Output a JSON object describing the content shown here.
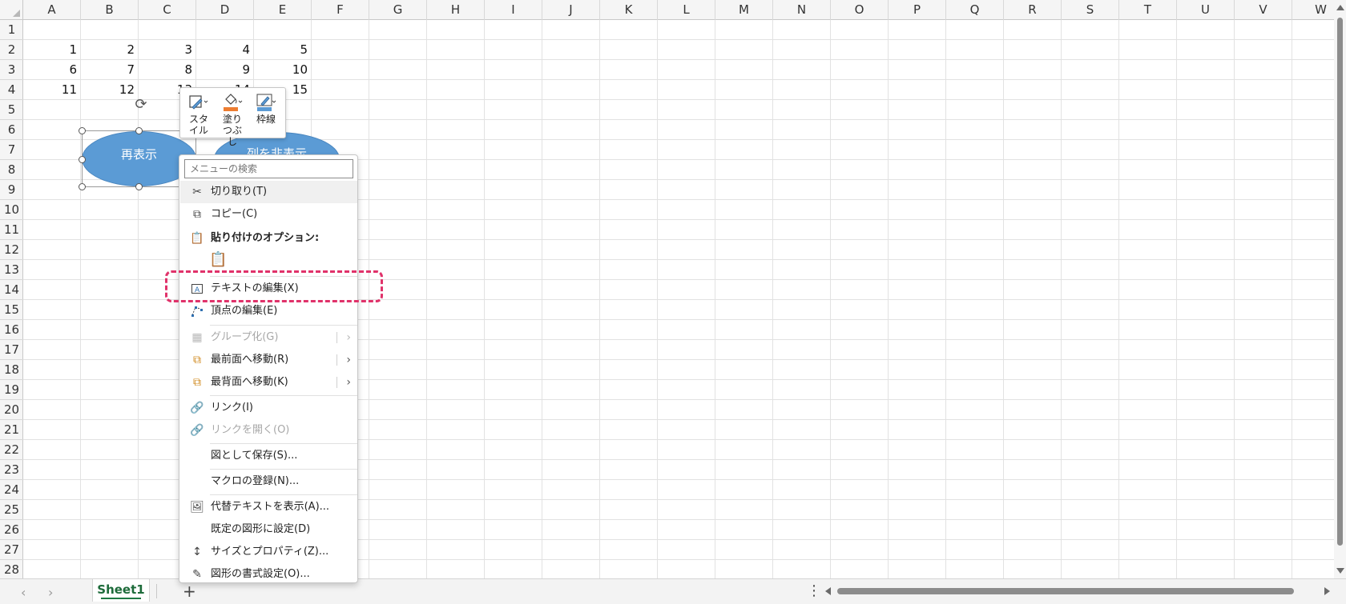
{
  "columns": [
    "A",
    "B",
    "C",
    "D",
    "E",
    "F",
    "G",
    "H",
    "I",
    "J",
    "K",
    "L",
    "M",
    "N",
    "O",
    "P",
    "Q",
    "R",
    "S",
    "T",
    "U",
    "V",
    "W"
  ],
  "rows": [
    "1",
    "2",
    "3",
    "4",
    "5",
    "6",
    "7",
    "8",
    "9",
    "10",
    "11",
    "12",
    "13",
    "14",
    "15",
    "16",
    "17",
    "18",
    "19",
    "20",
    "21",
    "22",
    "23",
    "24",
    "25",
    "26",
    "27",
    "28"
  ],
  "cells": [
    {
      "row": 2,
      "col": 0,
      "value": "1"
    },
    {
      "row": 2,
      "col": 1,
      "value": "2"
    },
    {
      "row": 2,
      "col": 2,
      "value": "3"
    },
    {
      "row": 2,
      "col": 3,
      "value": "4"
    },
    {
      "row": 2,
      "col": 4,
      "value": "5"
    },
    {
      "row": 3,
      "col": 0,
      "value": "6"
    },
    {
      "row": 3,
      "col": 1,
      "value": "7"
    },
    {
      "row": 3,
      "col": 2,
      "value": "8"
    },
    {
      "row": 3,
      "col": 3,
      "value": "9"
    },
    {
      "row": 3,
      "col": 4,
      "value": "10"
    },
    {
      "row": 4,
      "col": 0,
      "value": "11"
    },
    {
      "row": 4,
      "col": 1,
      "value": "12"
    },
    {
      "row": 4,
      "col": 2,
      "value": "13"
    },
    {
      "row": 4,
      "col": 3,
      "value": "14"
    },
    {
      "row": 4,
      "col": 4,
      "value": "15"
    }
  ],
  "shapes": {
    "shape1_label": "再表示",
    "shape2_label": "列を非表示"
  },
  "mini_toolbar": {
    "style_label": "スタイル",
    "fill_label": "塗りつぶし",
    "outline_label": "枠線",
    "fill_color": "#ed7d31",
    "outline_color": "#5b9bd5"
  },
  "context_menu": {
    "search_placeholder": "メニューの検索",
    "cut": "切り取り(T)",
    "copy": "コピー(C)",
    "paste_options": "貼り付けのオプション:",
    "edit_text": "テキストの編集(X)",
    "edit_points": "頂点の編集(E)",
    "group": "グループ化(G)",
    "bring_front": "最前面へ移動(R)",
    "send_back": "最背面へ移動(K)",
    "link": "リンク(I)",
    "open_link": "リンクを開く(O)",
    "save_as_picture": "図として保存(S)...",
    "assign_macro": "マクロの登録(N)...",
    "alt_text": "代替テキストを表示(A)...",
    "set_default_shape": "既定の図形に設定(D)",
    "size_properties": "サイズとプロパティ(Z)...",
    "format_shape": "図形の書式設定(O)..."
  },
  "sheet_tab": "Sheet1",
  "accent_color": "#e0326a"
}
